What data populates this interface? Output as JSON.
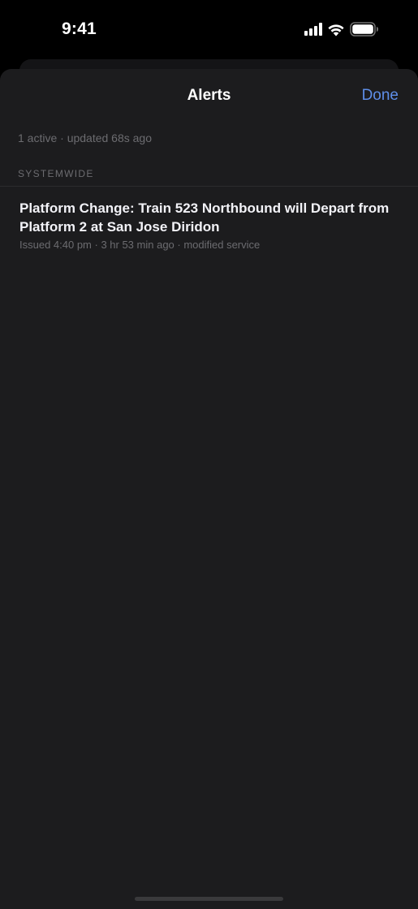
{
  "status_bar": {
    "time": "9:41"
  },
  "sheet": {
    "title": "Alerts",
    "done_label": "Done",
    "summary": "1 active · updated 68s ago",
    "section_header": "SYSTEMWIDE",
    "alerts": [
      {
        "title": "Platform Change: Train 523 Northbound will Depart from Platform 2 at San Jose Diridon",
        "meta": "Issued 4:40 pm · 3 hr 53 min ago · modified service"
      }
    ]
  },
  "colors": {
    "accent": "#5e8ee8",
    "sheet_background": "#1c1c1e",
    "secondary_text": "#6c6c70"
  }
}
